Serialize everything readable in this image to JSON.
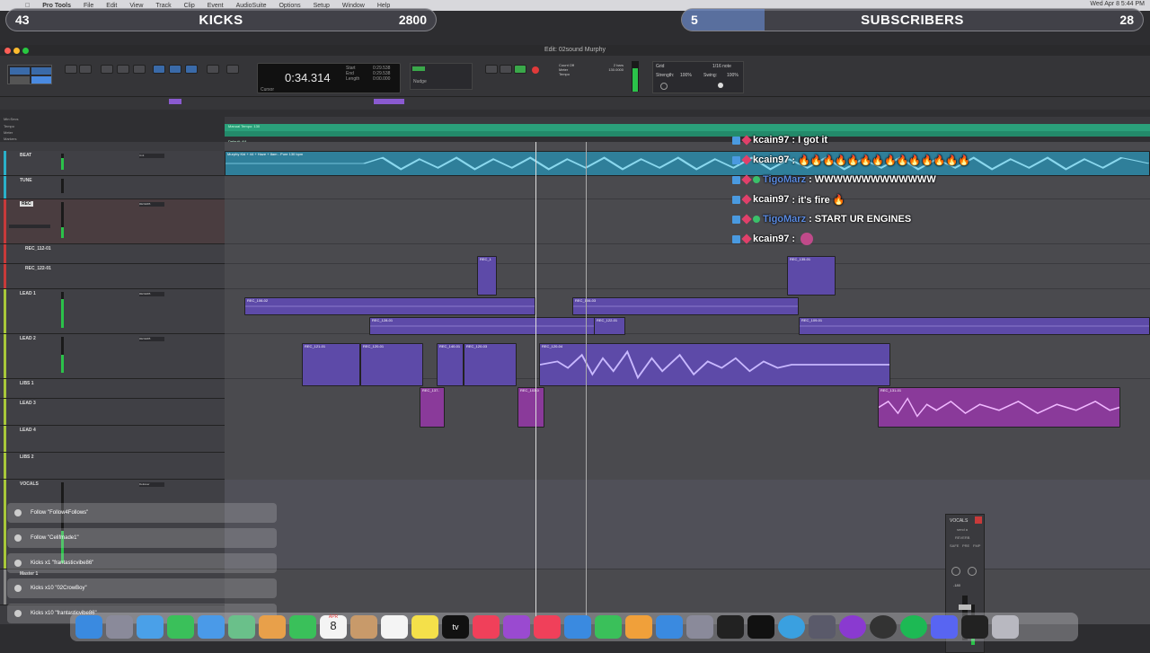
{
  "menubar": {
    "items": [
      "Pro Tools",
      "File",
      "Edit",
      "View",
      "Track",
      "Clip",
      "Event",
      "AudioSuite",
      "Options",
      "Setup",
      "Window",
      "Help"
    ],
    "clock": "Wed Apr 8  5:44 PM"
  },
  "overlay": {
    "kicks": {
      "left": "43",
      "title": "KICKS",
      "right": "2800",
      "progress": 0.015
    },
    "subs": {
      "left": "5",
      "title": "SUBSCRIBERS",
      "right": "28",
      "progress": 0.18
    }
  },
  "window": {
    "title": "Edit: 02sound Murphy"
  },
  "toolbar": {
    "counter_main": "0:34.314",
    "start_label": "Start",
    "start_val": "0:29.538",
    "end_label": "End",
    "end_val": "0:29.538",
    "length_label": "Length",
    "length_val": "0:00.000",
    "cursor_label": "Cursor",
    "nudge_label": "Nudge",
    "grid_label": "Grid",
    "grid_val": "1/16 note",
    "strength_label": "Strength:",
    "strength_val": "100%",
    "swing_label": "Swing:",
    "swing_val": "100%",
    "count_off": "Count Off",
    "meter_label": "Meter",
    "tempo_label": "Tempo",
    "tempo_val": "130.0000",
    "bars_val": "2 bars"
  },
  "rulers": {
    "labels": [
      "Min:Secs",
      "Tempo",
      "Meter",
      "Markers"
    ],
    "tempo_text": "Manual Tempo: 130",
    "meter_text": "Default: 4/4"
  },
  "tracks": [
    {
      "name": "BEAT",
      "insert": "Unit",
      "color": "#2ab0c8"
    },
    {
      "name": "TUNE",
      "insert": "",
      "color": "#2ab0c8"
    },
    {
      "name": "REC",
      "insert": "REVERB",
      "color": "#c83a3a",
      "highlight": true
    },
    {
      "name": "REC_112-01",
      "insert": "",
      "color": "#c83a3a"
    },
    {
      "name": "REC_122-01",
      "insert": "",
      "color": "#c83a3a"
    },
    {
      "name": "LEAD 1",
      "insert": "REVERB",
      "color": "#a8c83a"
    },
    {
      "name": "LEAD 2",
      "insert": "REVERB",
      "color": "#a8c83a"
    },
    {
      "name": "LIBS 1",
      "insert": "",
      "color": "#a8c83a"
    },
    {
      "name": "LEAD 3",
      "insert": "",
      "color": "#a8c83a"
    },
    {
      "name": "LEAD 4",
      "insert": "",
      "color": "#a8c83a"
    },
    {
      "name": "LIBS 2",
      "insert": "",
      "color": "#a8c83a"
    },
    {
      "name": "VOCALS",
      "insert": "DeEsser",
      "color": "#a8c83a"
    },
    {
      "name": "Master 1",
      "insert": "",
      "color": "#888"
    }
  ],
  "clips": [
    {
      "name": "Murphy Kid + 44 + Haze + 8am - Pure 130 bpm",
      "gain": "0 dB",
      "kind": "teal"
    },
    {
      "name": "REC_1",
      "gain": "",
      "kind": "purple"
    },
    {
      "name": "REC_106-02",
      "gain": "0 dB",
      "kind": "purple"
    },
    {
      "name": "REC_106-03",
      "gain": "0 dB",
      "kind": "purple"
    },
    {
      "name": "REC_128-01",
      "gain": "0 dB",
      "kind": "purple"
    },
    {
      "name": "REC_122-01",
      "gain": "0 dB",
      "kind": "purple"
    },
    {
      "name": "REC_109-01",
      "gain": "0 dB",
      "kind": "purple"
    },
    {
      "name": "REC_121-01",
      "gain": "0 dB",
      "kind": "purple"
    },
    {
      "name": "REC_120-01",
      "gain": "0 dB",
      "kind": "purple"
    },
    {
      "name": "REC_140-01",
      "gain": "0 dB",
      "kind": "purple"
    },
    {
      "name": "REC_120-03",
      "gain": "0 dB",
      "kind": "purple"
    },
    {
      "name": "REC_120-04",
      "gain": "0 dB",
      "kind": "purple"
    },
    {
      "name": "REC_137-",
      "gain": "0 dB",
      "kind": "magenta"
    },
    {
      "name": "REC_103-0",
      "gain": "0 dB",
      "kind": "magenta"
    },
    {
      "name": "REC_131-01",
      "gain": "0 dB",
      "kind": "magenta"
    },
    {
      "name": "REC_135-01",
      "gain": "0 dB",
      "kind": "purple"
    }
  ],
  "chat": [
    {
      "user": "kcain97",
      "text": ": I got it",
      "icons": [
        "twitch",
        "heart"
      ]
    },
    {
      "user": "kcain97",
      "text": ": 🔥🔥🔥🔥🔥🔥🔥🔥🔥🔥🔥🔥🔥🔥",
      "icons": [
        "twitch",
        "heart"
      ]
    },
    {
      "user": "TigoMarz",
      "text": ": WWWWWWWWWWWWW",
      "icons": [
        "twitch",
        "heart",
        "gem"
      ],
      "blue": true
    },
    {
      "user": "kcain97",
      "text": ": it's fire 🔥",
      "icons": [
        "twitch",
        "heart"
      ]
    },
    {
      "user": "TigoMarz",
      "text": ": START UR ENGINES",
      "icons": [
        "twitch",
        "heart",
        "gem"
      ],
      "blue": true
    },
    {
      "user": "kcain97",
      "text": ":",
      "icons": [
        "twitch",
        "heart"
      ]
    }
  ],
  "alerts": [
    {
      "text": "Follow \"Follow4Follows\"",
      "icon": "heart"
    },
    {
      "text": "Follow \"Celifmade1\"",
      "icon": "heart"
    },
    {
      "text": "Kicks x1 \"frantasticvibe86\"",
      "icon": "x"
    },
    {
      "text": "Kicks x10 \"02CrowBoy\"",
      "icon": "x"
    },
    {
      "text": "Kicks x10 \"frantasticvibe86\"",
      "icon": "x"
    }
  ],
  "minimixer": {
    "name": "VOCALS",
    "sub": "send a",
    "insert": "REVERB",
    "safe": "SAFE",
    "pre": "PRE",
    "fmp": "FMP",
    "level": "-180",
    "val": "-180"
  },
  "dock": {
    "calendar_day": "8",
    "calendar_month": "APR",
    "items": [
      "finder",
      "launchpad",
      "safari",
      "messages",
      "mail",
      "maps",
      "photos",
      "facetime",
      "calendar",
      "contacts",
      "reminders",
      "notes",
      "tv",
      "music",
      "podcasts",
      "news",
      "keynote",
      "numbers",
      "pages",
      "app-store",
      "system-settings",
      "logic",
      "ilok",
      "cycle",
      "avid",
      "protools",
      "obs",
      "spotify",
      "discord",
      "activity",
      "trash"
    ],
    "apple_tv_label": "tv"
  },
  "colors": {
    "accent_blue": "#3a6aa8",
    "teal_clip": "#2f7f9a",
    "purple_clip": "#5d4aa8",
    "magenta_clip": "#8a3a9a",
    "tempo_green": "#2aa07a"
  }
}
